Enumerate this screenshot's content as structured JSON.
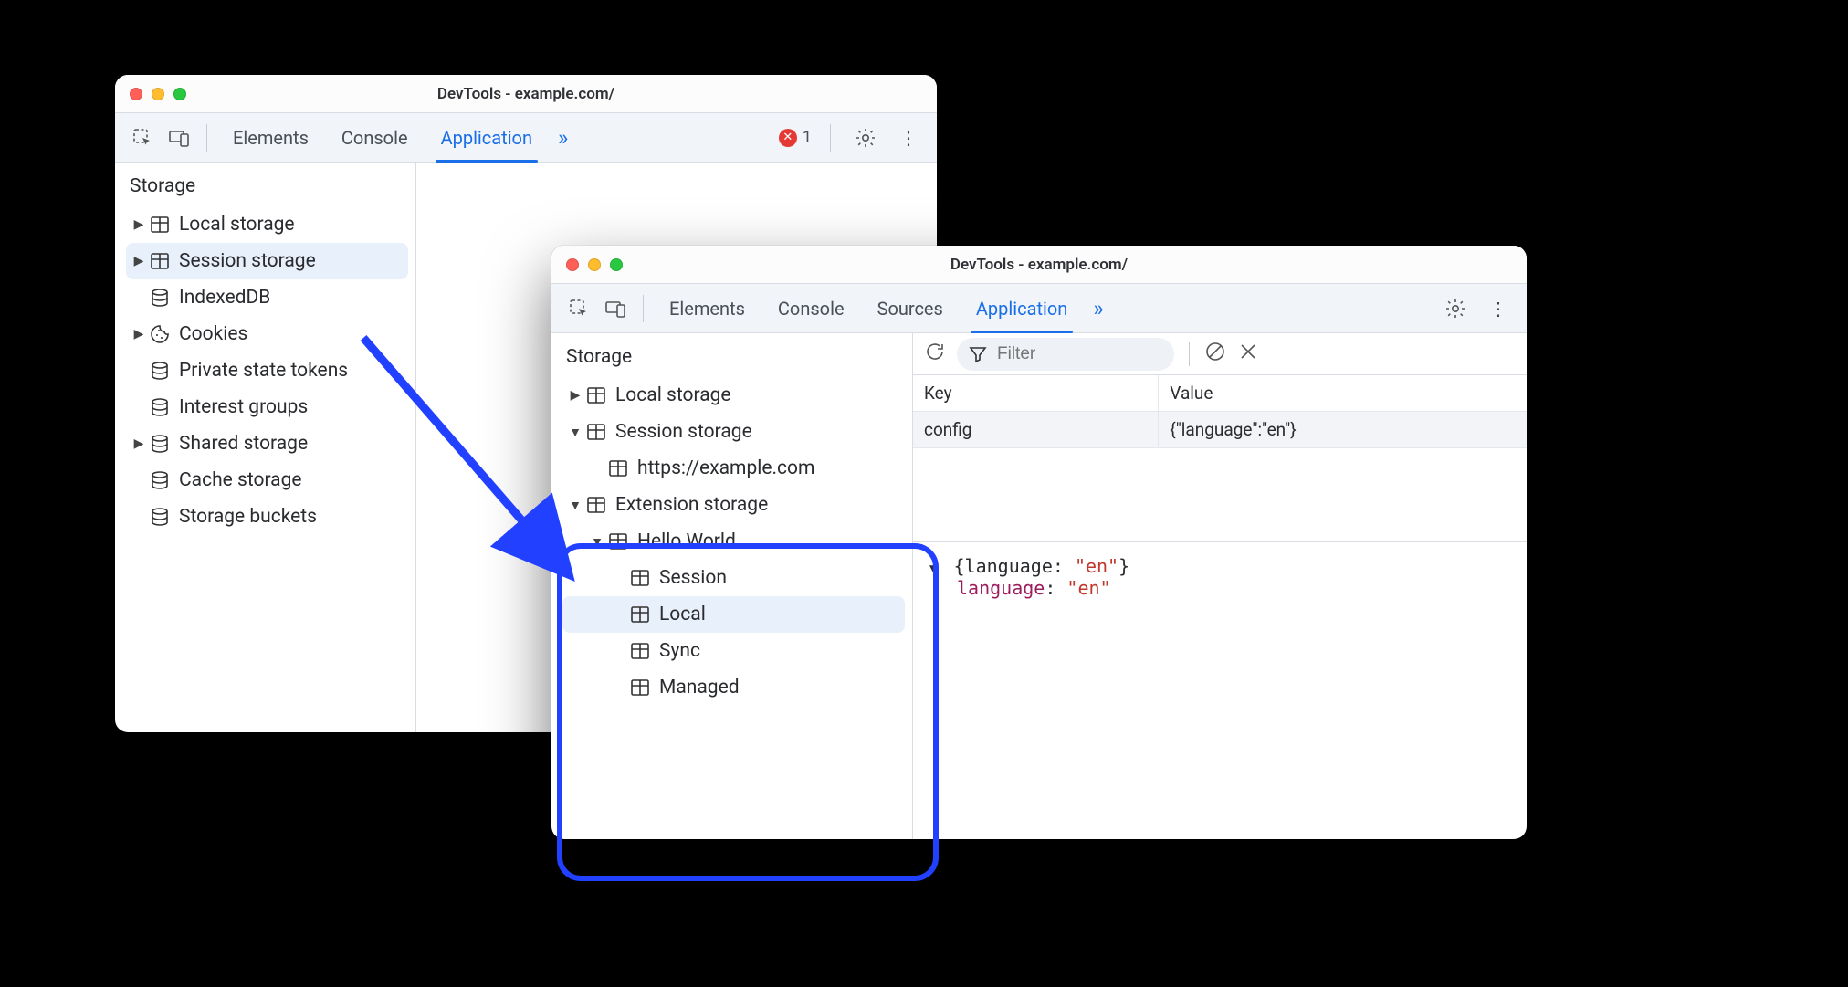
{
  "win1": {
    "title": "DevTools - example.com/",
    "tabs": {
      "elements": "Elements",
      "console": "Console",
      "application": "Application"
    },
    "error_count": "1",
    "storage_header": "Storage",
    "tree": {
      "local_storage": "Local storage",
      "session_storage": "Session storage",
      "indexeddb": "IndexedDB",
      "cookies": "Cookies",
      "private_state_tokens": "Private state tokens",
      "interest_groups": "Interest groups",
      "shared_storage": "Shared storage",
      "cache_storage": "Cache storage",
      "storage_buckets": "Storage buckets"
    }
  },
  "win2": {
    "title": "DevTools - example.com/",
    "tabs": {
      "elements": "Elements",
      "console": "Console",
      "sources": "Sources",
      "application": "Application"
    },
    "storage_header": "Storage",
    "tree": {
      "local_storage": "Local storage",
      "session_storage": "Session storage",
      "session_origin": "https://example.com",
      "extension_storage": "Extension storage",
      "ext_name": "Hello World",
      "ext_session": "Session",
      "ext_local": "Local",
      "ext_sync": "Sync",
      "ext_managed": "Managed"
    },
    "toolbar": {
      "filter_placeholder": "Filter"
    },
    "table": {
      "key_header": "Key",
      "value_header": "Value",
      "row0_key": "config",
      "row0_value": "{\"language\":\"en\"}"
    },
    "viewer": {
      "summary_pre": "{language: ",
      "summary_val": "\"en\"",
      "summary_post": "}",
      "prop_key": "language",
      "prop_sep": ": ",
      "prop_val": "\"en\""
    }
  }
}
